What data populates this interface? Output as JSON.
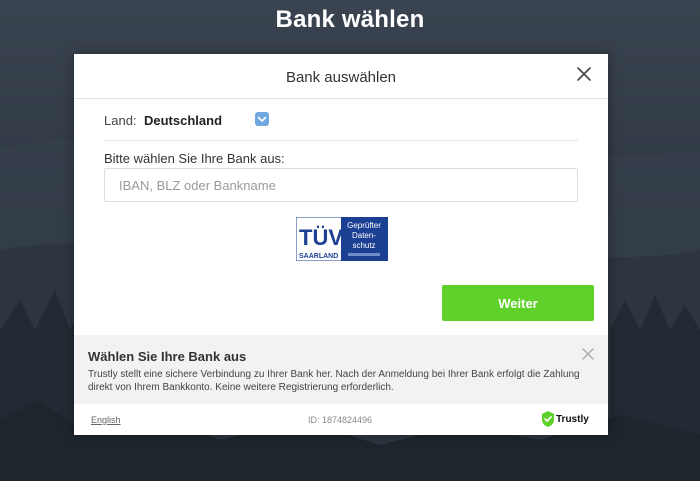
{
  "page": {
    "title": "Bank wählen"
  },
  "modal": {
    "title": "Bank auswählen",
    "country": {
      "label": "Land:",
      "value": "Deutschland"
    },
    "prompt": "Bitte wählen Sie Ihre Bank aus:",
    "search": {
      "placeholder": "IBAN, BLZ oder Bankname",
      "value": ""
    },
    "seal": {
      "brand": "TÜV",
      "region": "SAARLAND",
      "lines": [
        "Geprüfter",
        "Daten-",
        "schutz"
      ]
    },
    "continue_label": "Weiter",
    "info": {
      "title": "Wählen Sie Ihre Bank aus",
      "text": "Trustly stellt eine sichere Verbindung zu Ihrer Bank her. Nach der Anmeldung bei Ihrer Bank erfolgt die Zahlung direkt von Ihrem Bankkonto. Keine weitere Registrierung erforderlich."
    },
    "footer": {
      "language_link": "English",
      "id_text": "ID: 1874824496",
      "brand": "Trustly"
    }
  },
  "colors": {
    "accent_green": "#5fd12a",
    "select_blue": "#6fa8e0",
    "seal_blue": "#1b3f93"
  }
}
